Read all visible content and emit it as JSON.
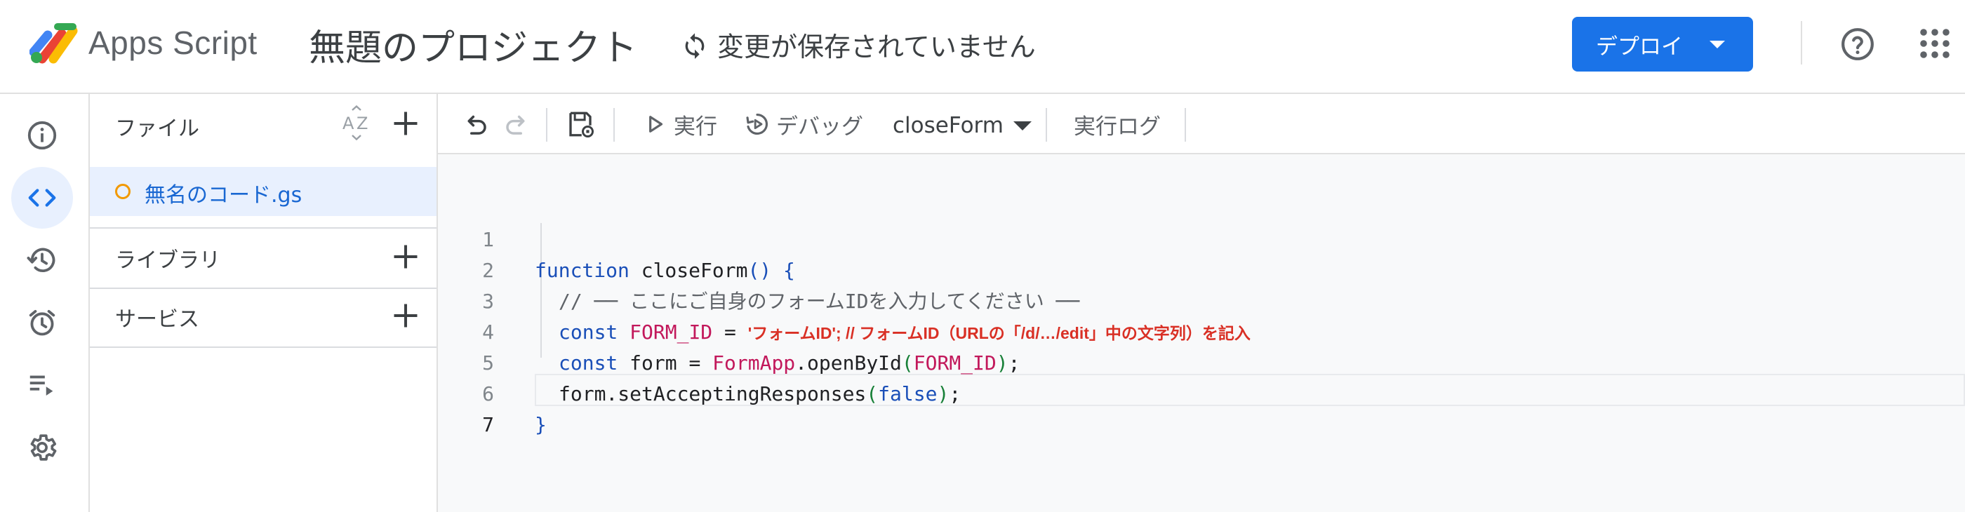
{
  "header": {
    "app_name": "Apps Script",
    "project_title": "無題のプロジェクト",
    "save_status": "変更が保存されていません",
    "deploy_label": "デプロイ"
  },
  "rail": {
    "items": [
      {
        "icon": "info-icon",
        "active": false
      },
      {
        "icon": "code-icon",
        "active": true
      },
      {
        "icon": "history-icon",
        "active": false
      },
      {
        "icon": "alarm-icon",
        "active": false
      },
      {
        "icon": "executions-icon",
        "active": false
      },
      {
        "icon": "settings-icon",
        "active": false
      }
    ]
  },
  "files_panel": {
    "files_label": "ファイル",
    "files": [
      {
        "name": "無名のコード.gs"
      }
    ],
    "libraries_label": "ライブラリ",
    "services_label": "サービス"
  },
  "toolbar": {
    "run_label": "実行",
    "debug_label": "デバッグ",
    "function_name": "closeForm",
    "log_label": "実行ログ"
  },
  "editor": {
    "line_numbers": [
      "1",
      "2",
      "3",
      "4",
      "5",
      "6",
      "7"
    ],
    "current_line": 7,
    "line1": {
      "kw": "function",
      "name": " closeForm",
      "p1": "()",
      "brace": " {"
    },
    "line2": {
      "comment": "// ── ここにご自身のフォームIDを入力してください ──"
    },
    "line3": {
      "kw": "const",
      "def": "FORM_ID",
      "eq": " = ",
      "rest": "'フォームID'; // フォームID（URLの「/d/…/edit」中の文字列）を記入"
    },
    "line4": {
      "kw": "const",
      "name": " form = ",
      "cls": "FormApp",
      "method": ".openById",
      "p_open": "(",
      "arg": "FORM_ID",
      "p_close": ")",
      "end": ";"
    },
    "line5": {
      "obj": "form.setAcceptingResponses",
      "p_open": "(",
      "arg": "false",
      "p_close": ")",
      "end": ";"
    },
    "line6": {
      "brace": "}"
    }
  },
  "colors": {
    "accent": "#1a73e8",
    "keyword": "#1a4fb8",
    "definition": "#c2185b",
    "warning_text": "#d93025",
    "file_dot": "#f29900"
  }
}
